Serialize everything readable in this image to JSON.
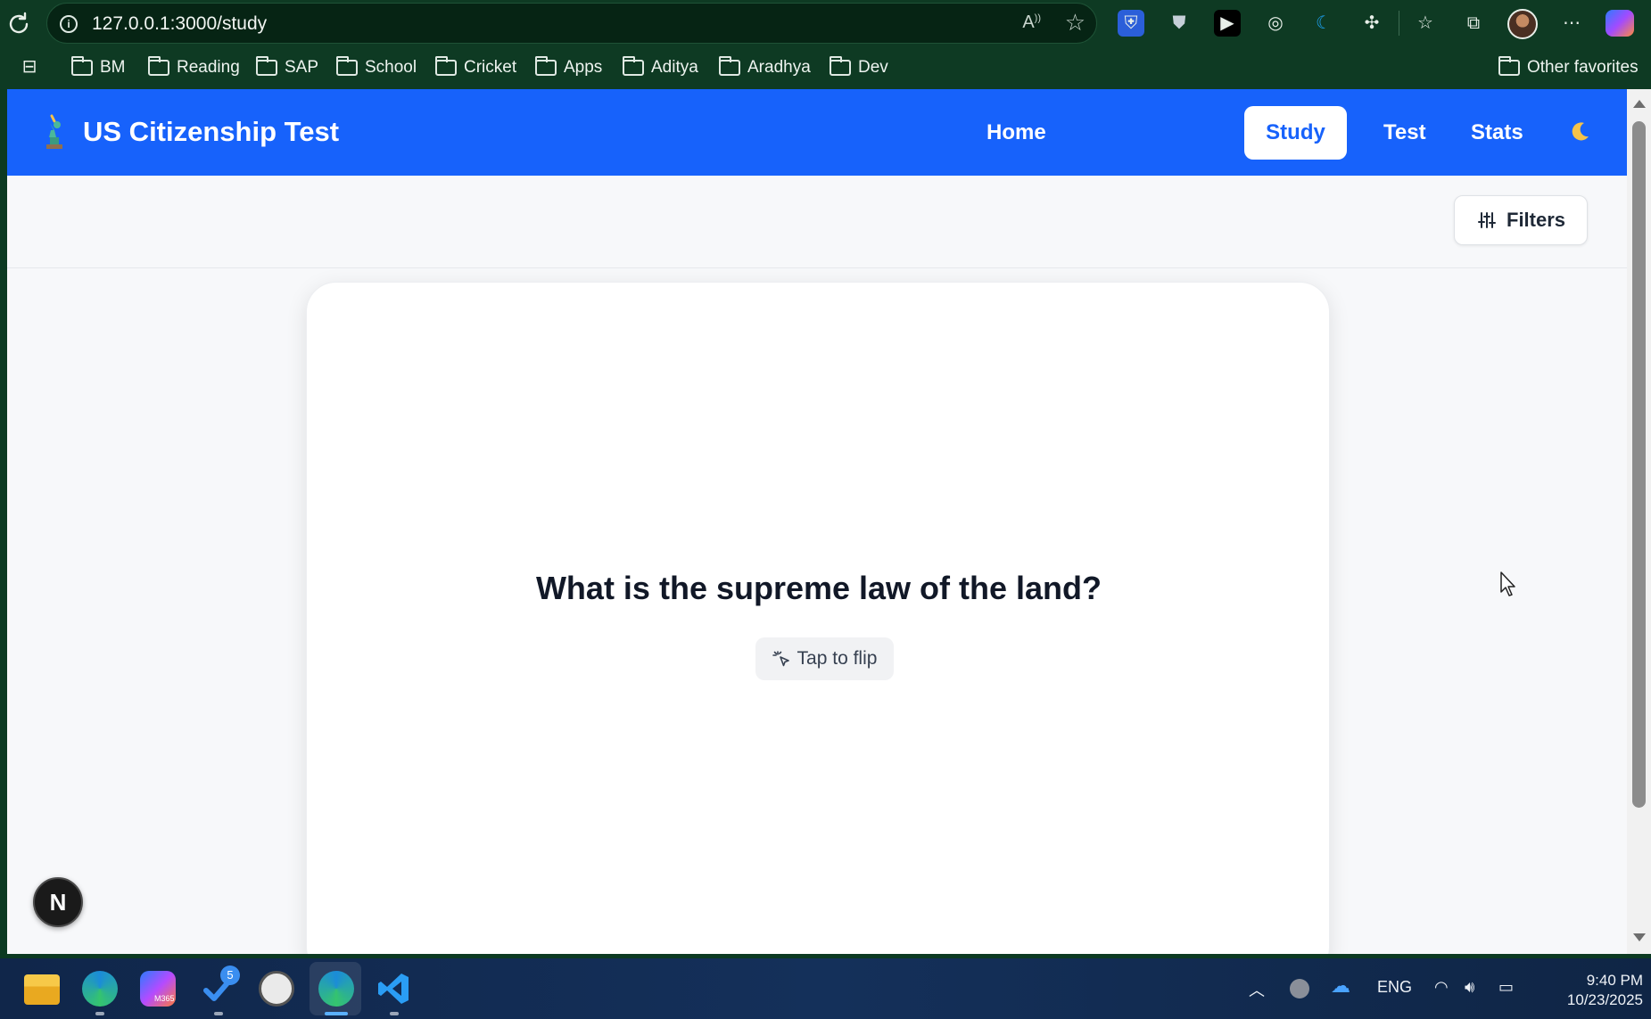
{
  "browser": {
    "url": "127.0.0.1:3000/study",
    "bookmarks": [
      "BM",
      "Reading",
      "SAP",
      "School",
      "Cricket",
      "Apps",
      "Aditya",
      "Aradhya",
      "Dev"
    ],
    "other_favorites": "Other favorites"
  },
  "app": {
    "brand": "US Citizenship Test",
    "nav": [
      {
        "label": "Home",
        "active": false
      },
      {
        "label": "Study",
        "active": true
      },
      {
        "label": "Test",
        "active": false
      },
      {
        "label": "Stats",
        "active": false
      }
    ],
    "accent_color": "#1762fb",
    "filters_label": "Filters",
    "card": {
      "question": "What is the supreme law of the land?",
      "flip_hint": "Tap to flip"
    },
    "dev_badge": "N"
  },
  "taskbar": {
    "ms365_label": "M365",
    "notification_count": "5",
    "language": "ENG",
    "time": "9:40 PM",
    "date": "10/23/2025"
  }
}
